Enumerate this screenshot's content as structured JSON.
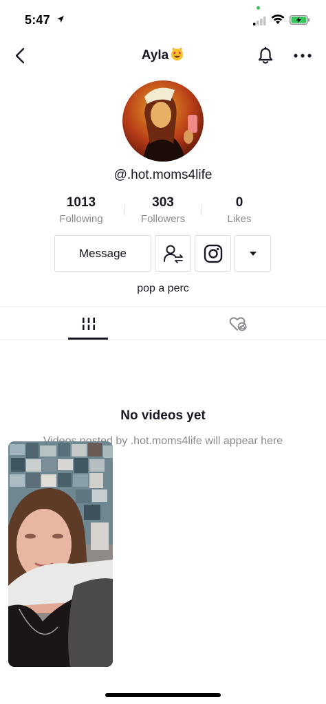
{
  "status_bar": {
    "time": "5:47"
  },
  "header": {
    "title": "Ayla",
    "title_emoji": "heart-eyes-cat-emoji"
  },
  "profile": {
    "username": "@.hot.moms4life",
    "bio": "pop a perc"
  },
  "stats": [
    {
      "value": "1013",
      "label": "Following"
    },
    {
      "value": "303",
      "label": "Followers"
    },
    {
      "value": "0",
      "label": "Likes"
    }
  ],
  "actions": {
    "message_label": "Message",
    "icons": [
      "add-friend-icon",
      "instagram-icon",
      "dropdown-arrow-icon"
    ]
  },
  "tabs": [
    {
      "name": "videos",
      "icon": "grid-icon",
      "active": true
    },
    {
      "name": "liked",
      "icon": "private-heart-icon",
      "active": false
    }
  ],
  "empty_state": {
    "title": "No videos yet",
    "subtitle": "Videos posted by .hot.moms4life will appear here"
  },
  "colors": {
    "text_primary": "#161823",
    "text_secondary": "#8a8b91",
    "border": "#dadadd",
    "status_green": "#35c759"
  }
}
